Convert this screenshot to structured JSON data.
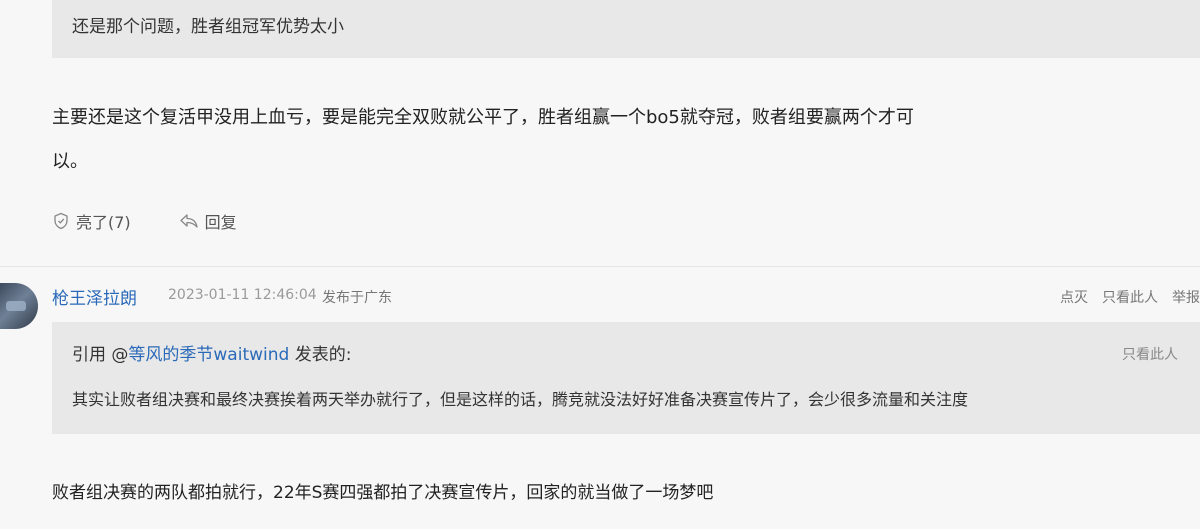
{
  "top_quote": {
    "text": "还是那个问题，胜者组冠军优势太小"
  },
  "comment1": {
    "body_line1": "主要还是这个复活甲没用上血亏，要是能完全双败就公平了，胜者组赢一个bo5就夺冠，败者组要赢两个才可",
    "body_line2": "以。",
    "like_label": "亮了(7)",
    "reply_label": "回复"
  },
  "comment2": {
    "username": "枪王泽拉朗",
    "timestamp": "2023-01-11 12:46:04",
    "location": "发布于广东",
    "tools": {
      "dim_label": "点灭",
      "only_label": "只看此人",
      "report_label": "举报"
    },
    "quote": {
      "prefix": "引用 @",
      "mention": "等风的季节waitwind",
      "suffix": " 发表的:",
      "only_label": "只看此人",
      "body": "其实让败者组决赛和最终决赛挨着两天举办就行了，但是这样的话，腾竞就没法好好准备决赛宣传片了，会少很多流量和关注度"
    },
    "body": "败者组决赛的两队都拍就行，22年S赛四强都拍了决赛宣传片，回家的就当做了一场梦吧"
  },
  "colors": {
    "link_blue": "#2a6ab8",
    "quote_bg": "#e8e8e8",
    "page_bg": "#f7f7f7"
  }
}
